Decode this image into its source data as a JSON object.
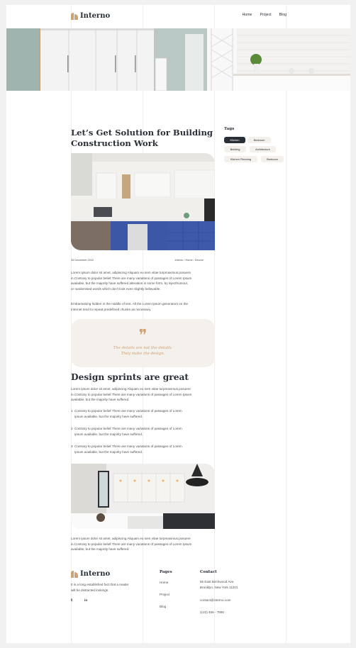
{
  "brand": {
    "name": "Interno"
  },
  "nav": {
    "items": [
      "Home",
      "Project",
      "Blog"
    ]
  },
  "article": {
    "title_line1": "Let’s Get Solution for Building",
    "title_line2": "Construction Work",
    "date": "26 December,2022",
    "breadcrumb": "Interior / Home / Decore",
    "intro_lines": [
      "Lorem Ipsum dolor sit amet, adipiscing Aliquam eu sem vitae turpmaximus.posuere",
      "in.Contrary to popular belief.There are many variations of passages of Lorem Ipsum",
      "available, but the majority have suffered alteration in some form, by injecthumour,",
      "or randomised words which don't look even slightly believable."
    ],
    "embarrassing_lines": [
      "Embarrassing hidden in the middle of text. All the Lorem Ipsum generators on the",
      "Internet tend to repeat predefined chunks as necessary."
    ],
    "quote_mark": "❞",
    "quote_lines": [
      "The details are not the details.",
      "They make the design."
    ],
    "section_title": "Design sprints are great",
    "section_lines": [
      "Lorem ipsum dolor sit amet, adipiscing Aliquam eu sem vitae turpmaximus.posuere",
      "in.Contrary to popular belief.There are many variations of passages of Lorem Ipsum",
      "available, but the majority have suffered."
    ],
    "bullets": [
      {
        "num": "1",
        "line1": "Contrary to popular belief.There are many variations of passages of Lorem",
        "line2": "Ipsum available, but the majority have suffered."
      },
      {
        "num": "2",
        "line1": "Contrary to popular belief.There are many variations of passages of Lorem",
        "line2": "Ipsum available, but the majority have suffered."
      },
      {
        "num": "3",
        "line1": "Contrary to popular belief.There are many variations of passages of Lorem",
        "line2": "Ipsum available, but the majority have suffered."
      }
    ],
    "outro_lines": [
      "Lorem ipsum dolor sit amet, adipiscing Aliquam eu sem vitae turpmaximus.posuere",
      "in.Contrary to popular belief.There are many variations of passages of Lorem Ipsum",
      "available, but the majority have suffered."
    ]
  },
  "tags": {
    "title": "Tags",
    "items": [
      "Kitchen",
      "Bedroom",
      "Building",
      "Architecture",
      "Kitchen Planning",
      "Bedroom"
    ],
    "active_index": 0
  },
  "footer": {
    "brand_name": "Interno",
    "about_lines": [
      "It is a long established fact that a reader",
      "will be distracted lookings."
    ],
    "social": {
      "twitter_label": "𝕥",
      "linkedin_label": "in"
    },
    "pages_title": "Pages",
    "pages": [
      "Home",
      "Project",
      "Blog"
    ],
    "contact_title": "Contact",
    "address_lines": [
      "55 East Birchwood Ave.",
      "Brooklyn, New York 11201"
    ],
    "email": "contact@interno.com",
    "phone": "(123) 456 - 7890"
  },
  "colors": {
    "accent": "#cda274",
    "dark": "#292f36",
    "cream": "#f4f0ec",
    "text": "#4d5053"
  }
}
